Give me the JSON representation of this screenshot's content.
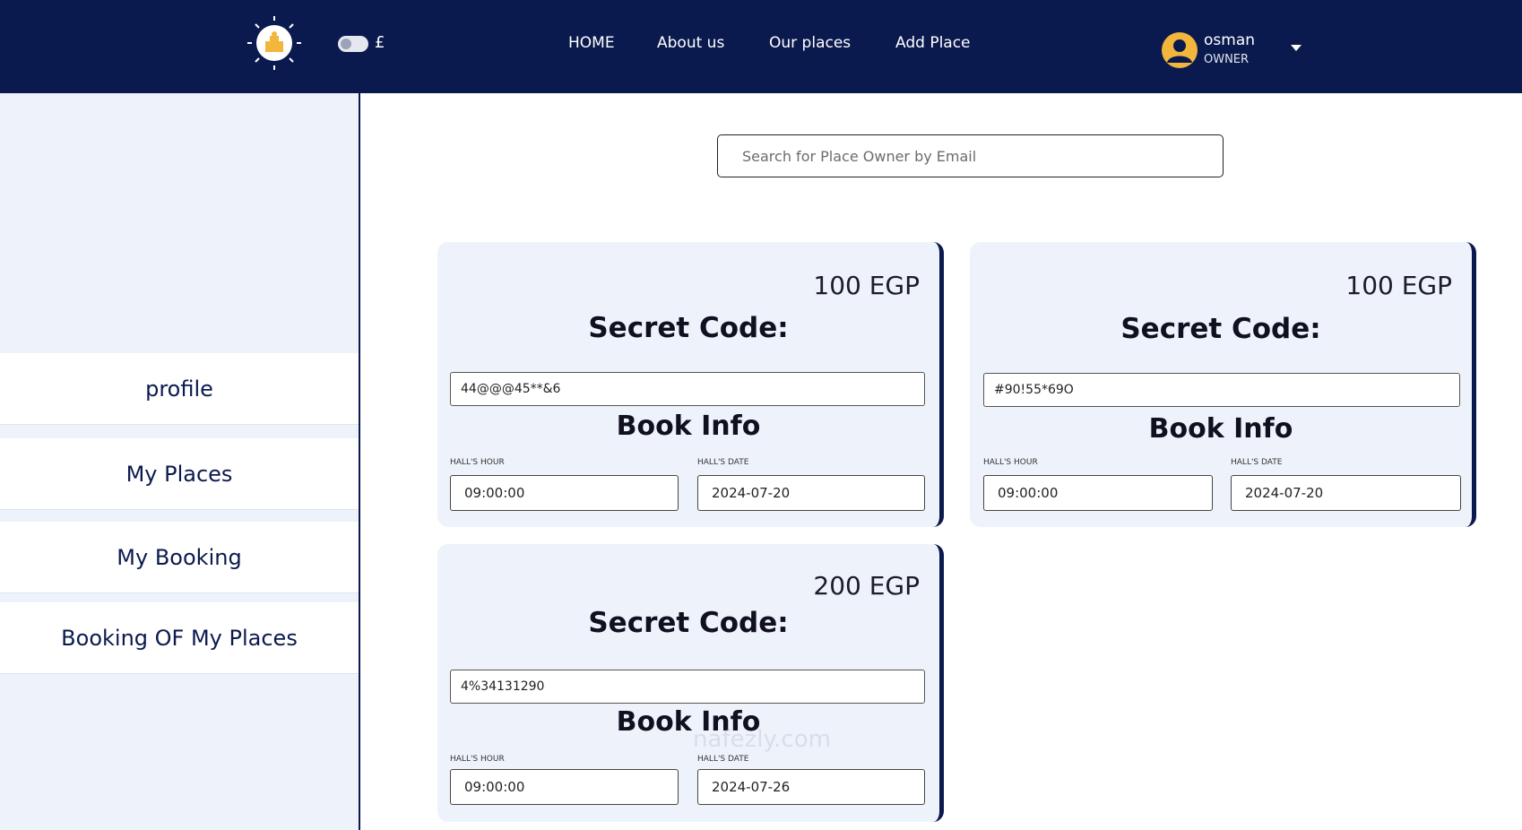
{
  "header": {
    "currency_symbol": "£",
    "nav": [
      {
        "label": "HOME"
      },
      {
        "label": "About us"
      },
      {
        "label": "Our places"
      },
      {
        "label": "Add Place"
      }
    ],
    "user": {
      "name": "osman",
      "role": "OWNER"
    }
  },
  "sidebar": {
    "items": [
      {
        "label": "profile"
      },
      {
        "label": "My Places"
      },
      {
        "label": "My Booking"
      },
      {
        "label": "Booking OF My Places"
      }
    ]
  },
  "search": {
    "placeholder": "Search for Place Owner by Email",
    "value": ""
  },
  "cards": [
    {
      "price": "100 EGP",
      "secret_title": "Secret Code:",
      "secret_code": "44@@@45**&6",
      "book_title": "Book Info",
      "hour_label": "HALL'S HOUR",
      "date_label": "HALL'S DATE",
      "hour": "09:00:00",
      "date": "2024-07-20"
    },
    {
      "price": "100 EGP",
      "secret_title": "Secret Code:",
      "secret_code": "#90!55*69O",
      "book_title": "Book Info",
      "hour_label": "HALL'S HOUR",
      "date_label": "HALL'S DATE",
      "hour": "09:00:00",
      "date": "2024-07-20"
    },
    {
      "price": "200 EGP",
      "secret_title": "Secret Code:",
      "secret_code": "4%34131290",
      "book_title": "Book Info",
      "hour_label": "HALL'S HOUR",
      "date_label": "HALL'S DATE",
      "hour": "09:00:00",
      "date": "2024-07-26"
    }
  ],
  "watermark": "nafezly.com",
  "colors": {
    "header_bg": "#0b1a4e",
    "sidebar_bg": "#eef3fb",
    "card_bg": "#eef3fb",
    "avatar": "#f2b63c"
  }
}
